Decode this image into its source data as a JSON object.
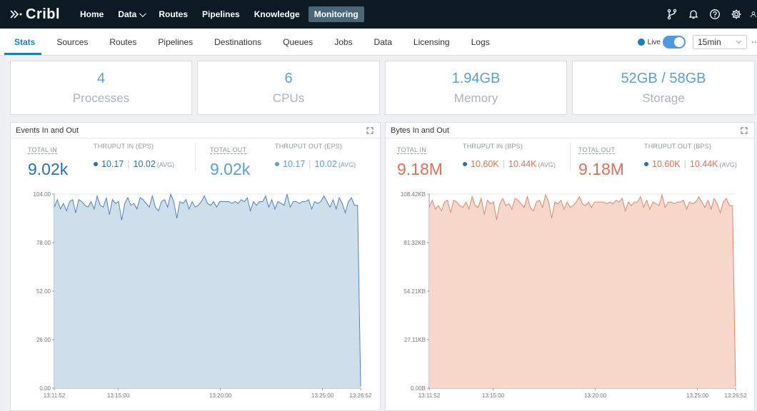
{
  "topnav": {
    "logo_text": "Cribl",
    "items": [
      "Home",
      "Data",
      "Routes",
      "Pipelines",
      "Knowledge",
      "Monitoring"
    ],
    "active": "Monitoring",
    "icons": [
      "branch-icon",
      "bell-icon",
      "help-icon",
      "gear-icon",
      "user-icon"
    ]
  },
  "tabs": {
    "items": [
      "Stats",
      "Sources",
      "Routes",
      "Pipelines",
      "Destinations",
      "Queues",
      "Jobs",
      "Data",
      "Licensing",
      "Logs"
    ],
    "active": "Stats"
  },
  "controls": {
    "live_label": "Live",
    "live_on": true,
    "time_range": "15min"
  },
  "cards": [
    {
      "value": "4",
      "label": "Processes"
    },
    {
      "value": "6",
      "label": "CPUs"
    },
    {
      "value": "1.94GB",
      "label": "Memory"
    },
    {
      "value": "52GB / 58GB",
      "label": "Storage"
    }
  ],
  "events_panel": {
    "title": "Events In and Out",
    "total_in_label": "TOTAL IN",
    "total_in": "9.02k",
    "thruput_in_label": "THRUPUT IN (EPS)",
    "thruput_in": "10.17",
    "thruput_in_avg": "10.02",
    "total_out_label": "TOTAL OUT",
    "total_out": "9.02k",
    "thruput_out_label": "THRUPUT OUT (EPS)",
    "thruput_out": "10.17",
    "thruput_out_avg": "10.02",
    "avg_label": "(AVG)"
  },
  "bytes_panel": {
    "title": "Bytes In and Out",
    "total_in_label": "TOTAL IN",
    "total_in": "9.18M",
    "thruput_in_label": "THRUPUT IN (BPS)",
    "thruput_in": "10.60K",
    "thruput_in_avg": "10.44K",
    "total_out_label": "TOTAL OUT",
    "total_out": "9.18M",
    "thruput_out_label": "THRUPUT OUT (BPS)",
    "thruput_out": "10.60K",
    "thruput_out_avg": "10.44K",
    "avg_label": "(AVG)"
  },
  "colors": {
    "events_line": "#4f83b9",
    "events_fill": "#cfdeeb",
    "bytes_line": "#e0866b",
    "bytes_fill": "#f6d7c9"
  },
  "chart_data": [
    {
      "type": "area",
      "title": "Events In and Out",
      "y_ticks": [
        "0.00",
        "26.00",
        "52.00",
        "78.00",
        "104.00"
      ],
      "ylim": [
        0,
        104
      ],
      "x_ticks": [
        "13:11:52",
        "13:15:00",
        "13:20:00",
        "13:25:00",
        "13:26:52"
      ],
      "x_tick_seconds": [
        0,
        188,
        488,
        788,
        900
      ],
      "x_range_seconds": [
        0,
        900
      ],
      "grid": true,
      "values": [
        97,
        101,
        96,
        99,
        95,
        100,
        101,
        94,
        101,
        100,
        98,
        97,
        100,
        96,
        103,
        98,
        97,
        102,
        93,
        101,
        99,
        100,
        90,
        99,
        102,
        98,
        99,
        96,
        102,
        101,
        99,
        97,
        103,
        97,
        95,
        100,
        101,
        97,
        104,
        100,
        91,
        100,
        99,
        101,
        96,
        100,
        97,
        98,
        100,
        103,
        99,
        98,
        100,
        97,
        100,
        100,
        100,
        100,
        99,
        100,
        99,
        101,
        100,
        102,
        95,
        100,
        98,
        100,
        100,
        103,
        97,
        101,
        96,
        100,
        99,
        98,
        104,
        97,
        100,
        100,
        99,
        100,
        100,
        101,
        96,
        100,
        99,
        100,
        103,
        100,
        97,
        101,
        96,
        102,
        99,
        94,
        100,
        102,
        98,
        98,
        1
      ]
    },
    {
      "type": "area",
      "title": "Bytes In and Out",
      "y_ticks": [
        "0.00B",
        "27.11KB",
        "54.21KB",
        "81.32KB",
        "108.42KB"
      ],
      "ylim": [
        0,
        108.42
      ],
      "y_unit": "KB",
      "x_ticks": [
        "13:11:52",
        "13:15:00",
        "13:20:00",
        "13:25:00",
        "13:26:52"
      ],
      "x_tick_seconds": [
        0,
        188,
        488,
        788,
        900
      ],
      "x_range_seconds": [
        0,
        900
      ],
      "grid": true,
      "values": [
        101,
        105,
        100,
        102,
        99,
        104,
        105,
        98,
        105,
        104,
        102,
        101,
        104,
        100,
        107,
        102,
        101,
        106,
        97,
        105,
        103,
        104,
        94,
        103,
        106,
        102,
        103,
        100,
        106,
        105,
        103,
        101,
        107,
        101,
        99,
        104,
        105,
        101,
        108,
        104,
        95,
        104,
        103,
        105,
        100,
        104,
        101,
        102,
        104,
        107,
        103,
        102,
        104,
        101,
        104,
        104,
        104,
        104,
        103,
        104,
        103,
        105,
        104,
        106,
        99,
        104,
        102,
        104,
        104,
        107,
        101,
        105,
        100,
        104,
        103,
        102,
        108,
        101,
        104,
        104,
        103,
        104,
        104,
        105,
        100,
        104,
        103,
        104,
        107,
        104,
        101,
        105,
        100,
        106,
        103,
        98,
        104,
        106,
        102,
        102,
        1
      ]
    }
  ]
}
